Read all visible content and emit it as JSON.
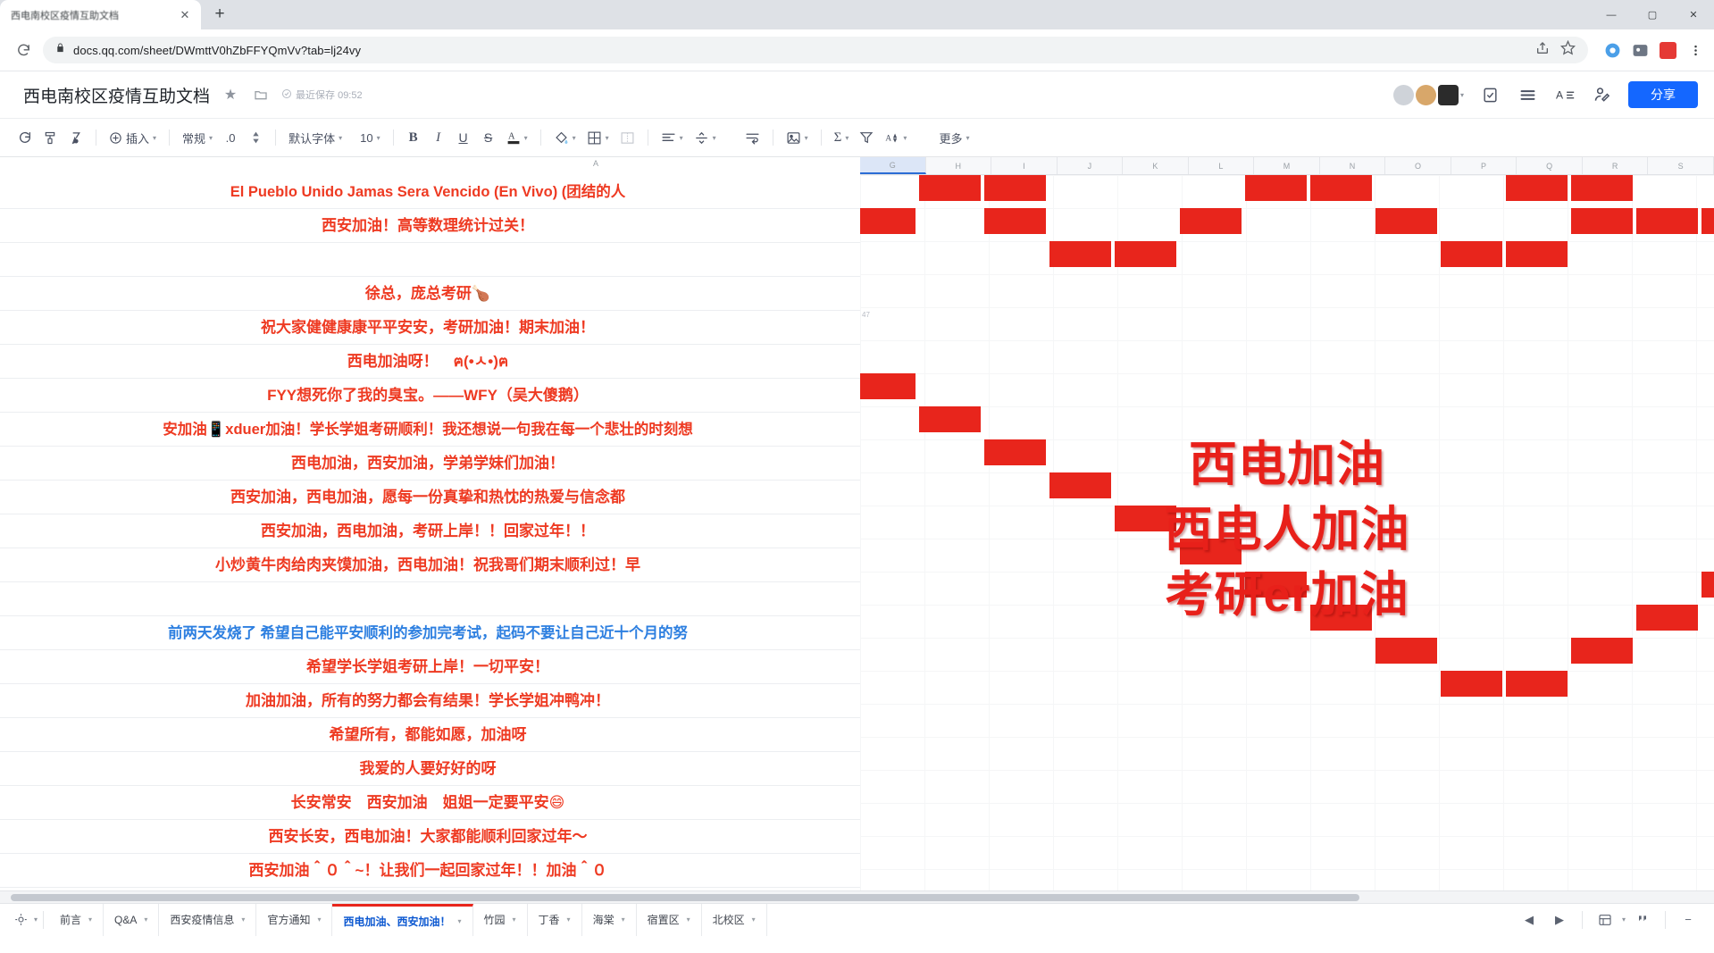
{
  "browser": {
    "tab_title": "西电南校区疫情互助文档",
    "tab_close": "✕",
    "new_tab": "+",
    "window_minimize": "—",
    "window_maximize": "▢",
    "window_close": "✕",
    "reload_icon": "reload-icon",
    "lock_icon": "lock-icon",
    "url": "docs.qq.com/sheet/DWmttV0hZbFFYQmVv?tab=lj24vy",
    "share_page_icon": "share-page-icon",
    "bookmark_icon": "star-icon",
    "extension_icon": "extension-icon",
    "profile_icon": "profile-icon",
    "menu_icon": "menu-icon"
  },
  "doc": {
    "title": "西电南校区疫情互助文档",
    "star_icon": "★",
    "folder_icon": "folder-icon",
    "saved_icon": "✓",
    "saved_text": "最近保存 09:52",
    "avatars": [
      "",
      "",
      "QQ"
    ],
    "avatar_caret": "▾",
    "todo_icon": "todo-icon",
    "outline_icon": "outline-icon",
    "font-size-icon": "A≡",
    "edit-user-icon": "edit-user-icon",
    "share_label": "分享"
  },
  "toolbar": {
    "redo_icon": "↻",
    "format_painter_icon": "format-painter-icon",
    "clear_format_icon": "clear-format-icon",
    "insert_icon": "⊕",
    "insert_label": "插入",
    "number_format_label": "常规",
    "decimal_label": ".0",
    "decimal_stepper": "⁚",
    "font_label": "默认字体",
    "font_size_label": "10",
    "bold": "B",
    "italic": "I",
    "underline": "U",
    "strikethrough": "S",
    "text_color": "A",
    "fill_color_icon": "fill-color-icon",
    "borders_icon": "borders-icon",
    "merge_icon": "merge-cells-icon",
    "align_icon": "align-icon",
    "valign_icon": "vertical-align-icon",
    "wrap_icon": "wrap-text-icon",
    "image_icon": "image-icon",
    "sum_icon": "Σ",
    "filter_icon": "filter-icon",
    "sort_icon": "sort-icon",
    "more_label": "更多",
    "caret": "▾"
  },
  "sheet": {
    "left_col_label": "A",
    "right_columns": [
      "G",
      "H",
      "I",
      "J",
      "K",
      "L",
      "M",
      "N",
      "O",
      "P",
      "Q",
      "R",
      "S"
    ],
    "row_marker": "47",
    "messages": [
      {
        "text": "El Pueblo Unido Jamas Sera Vencido (En Vivo) (团结的人",
        "color": "red"
      },
      {
        "text": "西安加油！高等数理统计过关！",
        "color": "red"
      },
      {
        "text": "",
        "color": "red"
      },
      {
        "text": "徐总，庞总考研🍗",
        "color": "red"
      },
      {
        "text": "祝大家健健康康平平安安，考研加油！期末加油！",
        "color": "red"
      },
      {
        "text": "西电加油呀！　ฅ(•ㅅ•)ฅ",
        "color": "red"
      },
      {
        "text": "FYY想死你了我的臭宝。——WFY（吴大傻鹅）",
        "color": "red"
      },
      {
        "text": "安加油📱xduer加油！学长学姐考研顺利！我还想说一句我在每一个悲壮的时刻想",
        "color": "red"
      },
      {
        "text": "西电加油，西安加油，学弟学妹们加油！",
        "color": "red"
      },
      {
        "text": "西安加油，西电加油，愿每一份真挚和热忱的热爱与信念都",
        "color": "red"
      },
      {
        "text": "西安加油，西电加油，考研上岸！！回家过年！！",
        "color": "red"
      },
      {
        "text": "小炒黄牛肉给肉夹馍加油，西电加油！祝我哥们期末顺利过！早",
        "color": "red"
      },
      {
        "text": "",
        "color": "red"
      },
      {
        "text": "前两天发烧了 希望自己能平安顺利的参加完考试，起码不要让自己近十个月的努",
        "color": "blue"
      },
      {
        "text": "希望学长学姐考研上岸！一切平安！",
        "color": "red"
      },
      {
        "text": "加油加油，所有的努力都会有结果！学长学姐冲鸭冲！",
        "color": "red"
      },
      {
        "text": "希望所有，都能如愿，加油呀",
        "color": "red"
      },
      {
        "text": "我爱的人要好好的呀",
        "color": "red"
      },
      {
        "text": "长安常安　西安加油　姐姐一定要平安😄",
        "color": "red"
      },
      {
        "text": "西安长安，西电加油！大家都能顺利回家过年～",
        "color": "red"
      },
      {
        "text": "西安加油＾０＾~！让我们一起回家过年！！加油＾０",
        "color": "red"
      }
    ],
    "art_lines": [
      "西电加油",
      "西电人加油",
      "考研er加油"
    ],
    "art_color": "#e8201a"
  },
  "bottom": {
    "all_sheets_icon": "all-sheets-icon",
    "add_sheet_icon": "add-sheet-icon",
    "tabs": [
      {
        "label": "前言",
        "active": false
      },
      {
        "label": "Q&A",
        "active": false
      },
      {
        "label": "西安疫情信息",
        "active": false
      },
      {
        "label": "官方通知",
        "active": false
      },
      {
        "label": "西电加油、西安加油！",
        "active": true
      },
      {
        "label": "竹园",
        "active": false
      },
      {
        "label": "丁香",
        "active": false
      },
      {
        "label": "海棠",
        "active": false
      },
      {
        "label": "宿置区",
        "active": false
      },
      {
        "label": "北校区",
        "active": false
      }
    ],
    "tab_caret": "▾",
    "nav_prev": "◀",
    "nav_next": "▶",
    "view_icon": "view-mode-icon",
    "comment_icon": "comment-icon",
    "zoom_minus": "−",
    "zoom_plus": "+"
  }
}
